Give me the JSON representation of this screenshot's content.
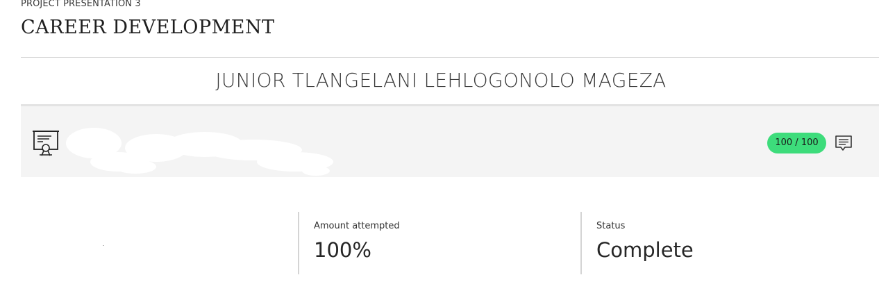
{
  "header": {
    "kicker": "PROJECT PRESENTATION 3",
    "title": "CAREER DEVELOPMENT"
  },
  "student": {
    "name": "JUNIOR TLANGELANI LEHLOGONOLO MAGEZA"
  },
  "submission_card": {
    "icon": "certificate-presentation-icon",
    "score": "100 / 100",
    "feedback_icon": "comment-icon"
  },
  "stats": {
    "attempted_label": "Amount attempted",
    "attempted_value": "100%",
    "status_label": "Status",
    "status_value": "Complete"
  },
  "colors": {
    "score_pill": "#3ddc7b",
    "card_bg": "#f4f4f4"
  }
}
